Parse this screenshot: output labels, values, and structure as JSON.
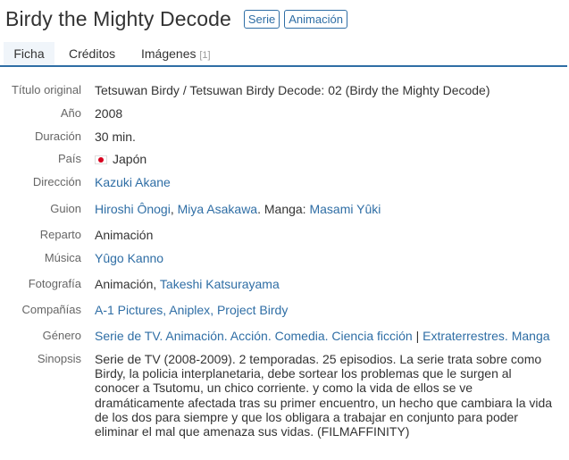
{
  "header": {
    "title": "Birdy the Mighty Decode",
    "badges": [
      "Serie",
      "Animación"
    ]
  },
  "tabs": [
    {
      "label": "Ficha",
      "active": true
    },
    {
      "label": "Créditos"
    },
    {
      "label": "Imágenes",
      "count": "[1]"
    }
  ],
  "fields": {
    "titulo_original": {
      "label": "Título original",
      "value": "Tetsuwan Birdy / Tetsuwan Birdy Decode: 02 (Birdy the Mighty Decode)"
    },
    "anio": {
      "label": "Año",
      "value": "2008"
    },
    "duracion": {
      "label": "Duración",
      "value": "30 min."
    },
    "pais": {
      "label": "País",
      "value": "Japón",
      "flag_icon": "japan-flag-icon"
    },
    "direccion": {
      "label": "Dirección",
      "links": [
        "Kazuki Akane"
      ]
    },
    "guion": {
      "label": "Guion",
      "links": [
        "Hiroshi Ônogi",
        "Miya Asakawa"
      ],
      "suffix": ". Manga: ",
      "links2": [
        "Masami Yûki"
      ],
      "sep": ", "
    },
    "reparto": {
      "label": "Reparto",
      "value": "Animación"
    },
    "musica": {
      "label": "Música",
      "links": [
        "Yûgo Kanno"
      ]
    },
    "fotografia": {
      "label": "Fotografía",
      "prefix": "Animación, ",
      "links": [
        "Takeshi Katsurayama"
      ]
    },
    "companias": {
      "label": "Compañías",
      "links": [
        "A-1 Pictures",
        "Aniplex",
        "Project Birdy"
      ],
      "sep": ", "
    },
    "genero": {
      "label": "Género",
      "links": [
        "Serie de TV",
        "Animación",
        "Acción",
        "Comedia",
        "Ciencia ficción"
      ],
      "divider": " | ",
      "links2": [
        "Extraterrestres",
        "Manga"
      ],
      "sep": ". "
    },
    "sinopsis": {
      "label": "Sinopsis",
      "value": "Serie de TV (2008-2009). 2 temporadas. 25 episodios. La serie trata sobre como Birdy, la policia interplanetaria, debe sortear los problemas que le surgen al conocer a Tsutomu, un chico corriente. y como la vida de ellos se ve dramáticamente afectada tras su primer encuentro, un hecho que cambiara la vida de los dos para siempre y que los obligara a trabajar en conjunto para poder eliminar el mal que amenaza sus vidas. (FILMAFFINITY)"
    }
  },
  "colors": {
    "link": "#2f6ea5",
    "tab_underline": "#2f6ea5",
    "active_tab_bg": "#f0f5fa",
    "flag_red": "#d7001e"
  }
}
